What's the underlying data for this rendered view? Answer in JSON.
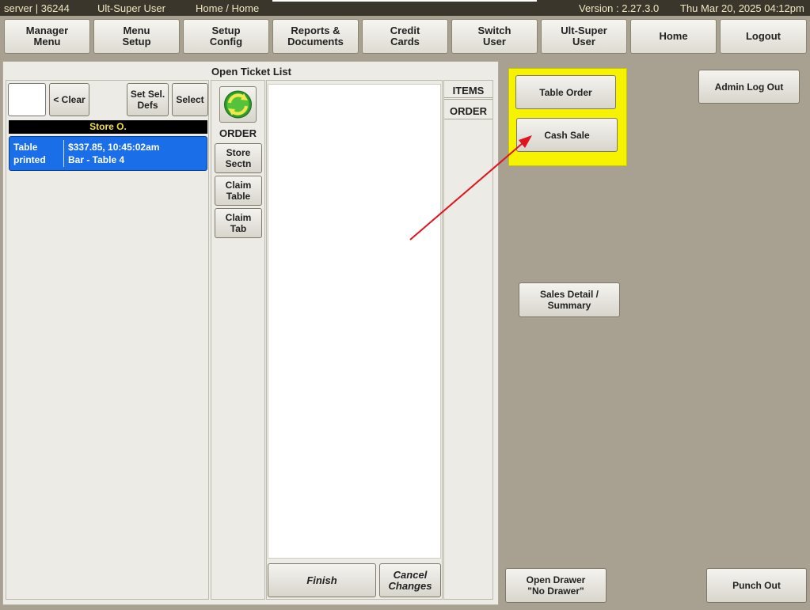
{
  "status": {
    "server": "server | 36244",
    "user": "Ult-Super User",
    "location": "Home / Home",
    "version": "Version : 2.27.3.0",
    "datetime": "Thu Mar 20, 2025  04:12pm"
  },
  "nav": [
    "Manager\nMenu",
    "Menu\nSetup",
    "Setup\nConfig",
    "Reports &\nDocuments",
    "Credit\nCards",
    "Switch\nUser",
    "Ult-Super\nUser",
    "Home",
    "Logout"
  ],
  "ticket_panel": {
    "title": "Open Ticket List",
    "clear_label": "< Clear",
    "set_sel_defs_label": "Set Sel.\nDefs",
    "select_label": "Select",
    "store_header": "Store O.",
    "ticket": {
      "left": "Table\nprinted",
      "amount_time": "$337.85, 10:45:02am",
      "location": "Bar - Table 4"
    },
    "order_label": "ORDER",
    "store_sectn_label": "Store\nSectn",
    "claim_table_label": "Claim\nTable",
    "claim_tab_label": "Claim\nTab",
    "items_tab": "ITEMS",
    "order_tab": "ORDER",
    "finish_label": "Finish",
    "cancel_label": "Cancel\nChanges"
  },
  "actions": {
    "table_order": "Table Order",
    "cash_sale": "Cash Sale",
    "admin_logout": "Admin Log Out",
    "sales_detail": "Sales Detail /\nSummary",
    "open_drawer": "Open Drawer\n\"No Drawer\"",
    "punch_out": "Punch Out"
  },
  "colors": {
    "highlight": "#f6f200",
    "ticket_bg": "#1a6ee8",
    "annotation_arrow": "#e0141c"
  },
  "icons": {
    "refresh": "refresh-icon",
    "arrow": "annotation-arrow"
  }
}
